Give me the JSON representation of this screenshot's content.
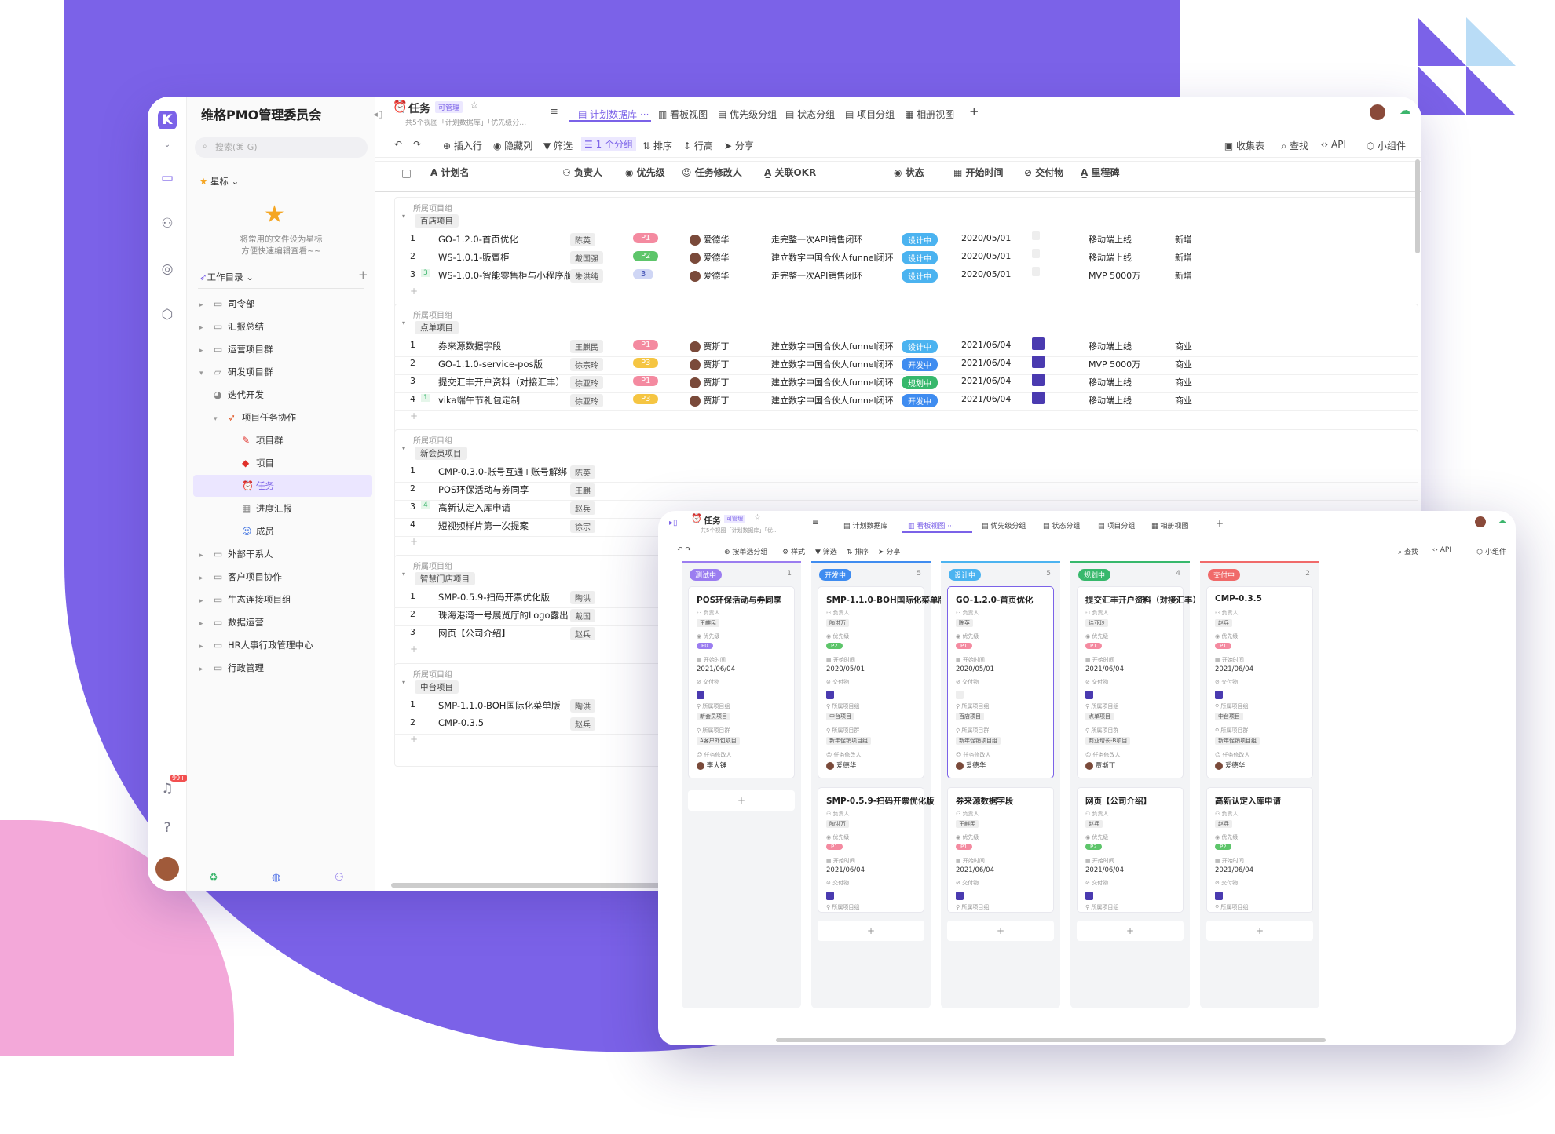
{
  "colors": {
    "brand": "#7b62e8",
    "pink": "#f3a8d9",
    "p0": "#9b7df0",
    "p1": "#f48aa0",
    "p2": "#5dc56a",
    "p3": "#f5c542",
    "status_design": "#4bb3f0",
    "status_dev": "#3f8cf0",
    "status_plan": "#37b86c",
    "status_test": "#9b7df0",
    "status_deliver": "#f06a6a"
  },
  "sidebar": {
    "workspace": "维格PMO管理委员会",
    "search_placeholder": "搜索(⌘ G)",
    "starred": "星标",
    "starred_hint": "将常用的文件设为星标\n方便快速编辑查看~~",
    "catalog": "工作目录",
    "items": [
      "司令部",
      "汇报总结",
      "运营项目群",
      "研发项目群",
      "迭代开发",
      "项目任务协作",
      "项目群",
      "项目",
      "任务",
      "进度汇报",
      "成员",
      "外部干系人",
      "客户项目协作",
      "生态连接项目组",
      "数据运营",
      "HR人事行政管理中心",
      "行政管理"
    ],
    "badge": "99+"
  },
  "header": {
    "title": "任务",
    "perm": "可管理",
    "desc": "共5个视图「计划数据库」「优先级分…",
    "tabs": [
      "计划数据库",
      "看板视图",
      "优先级分组",
      "状态分组",
      "项目分组",
      "相册视图"
    ]
  },
  "toolbar": {
    "undo": "↶",
    "redo": "↷",
    "insert": "插入行",
    "hide": "隐藏列",
    "filter": "筛选",
    "group": "1 个分组",
    "sort": "排序",
    "rowh": "行高",
    "share": "分享",
    "collect": "收集表",
    "find": "查找",
    "api": "API",
    "widget": "小组件"
  },
  "columns": [
    "计划名",
    "负责人",
    "优先级",
    "任务修改人",
    "关联OKR",
    "状态",
    "开始时间",
    "交付物",
    "里程碑"
  ],
  "group_label": "所属项目组",
  "groups": [
    {
      "name": "百店项目",
      "rows": [
        {
          "n": "1",
          "name": "GO-1.2.0-首页优化",
          "owner": "陈英",
          "pri": "P1",
          "editor": "爱德华",
          "okr": "走完整一次API销售闭环",
          "status": "设计中",
          "date": "2020/05/01",
          "mile": "移动端上线",
          "extra": "新增"
        },
        {
          "n": "2",
          "name": "WS-1.0.1-販賣柜",
          "owner": "戴国强",
          "pri": "P2",
          "editor": "爱德华",
          "okr": "建立数字中国合伙人funnel闭环",
          "status": "设计中",
          "date": "2020/05/01",
          "mile": "移动端上线",
          "extra": "新增"
        },
        {
          "n": "3",
          "sub": "3",
          "name": "WS-1.0.0-智能零售柜与小程序版",
          "owner": "朱洪纯",
          "pri": "3",
          "editor": "爱德华",
          "okr": "走完整一次API销售闭环",
          "status": "设计中",
          "date": "2020/05/01",
          "mile": "MVP 5000万",
          "extra": "新增"
        }
      ]
    },
    {
      "name": "点单项目",
      "rows": [
        {
          "n": "1",
          "name": "券来源数据字段",
          "owner": "王麒民",
          "pri": "P1",
          "editor": "贾斯丁",
          "okr": "建立数字中国合伙人funnel闭环",
          "status": "设计中",
          "date": "2021/06/04",
          "mile": "移动端上线",
          "extra": "商业"
        },
        {
          "n": "2",
          "name": "GO-1.1.0-service-pos版",
          "owner": "徐宗玲",
          "pri": "P3",
          "editor": "贾斯丁",
          "okr": "建立数字中国合伙人funnel闭环",
          "status": "开发中",
          "date": "2021/06/04",
          "mile": "MVP 5000万",
          "extra": "商业"
        },
        {
          "n": "3",
          "name": "提交汇丰开户资料（对接汇丰）",
          "owner": "徐亚玲",
          "pri": "P1",
          "editor": "贾斯丁",
          "okr": "建立数字中国合伙人funnel闭环",
          "status": "规划中",
          "date": "2021/06/04",
          "mile": "移动端上线",
          "extra": "商业"
        },
        {
          "n": "4",
          "sub": "1",
          "name": "vika端午节礼包定制",
          "owner": "徐亚玲",
          "pri": "P3",
          "editor": "贾斯丁",
          "okr": "建立数字中国合伙人funnel闭环",
          "status": "开发中",
          "date": "2021/06/04",
          "mile": "移动端上线",
          "extra": "商业"
        }
      ]
    },
    {
      "name": "新会员项目",
      "rows": [
        {
          "n": "1",
          "name": "CMP-0.3.0-账号互通+账号解绑",
          "owner": "陈英"
        },
        {
          "n": "2",
          "name": "POS环保活动与券同享",
          "owner": "王麒"
        },
        {
          "n": "3",
          "sub": "4",
          "name": "高新认定入库申请",
          "owner": "赵兵"
        },
        {
          "n": "4",
          "name": "短视频样片第一次提案",
          "owner": "徐宗"
        }
      ]
    },
    {
      "name": "智慧门店项目",
      "rows": [
        {
          "n": "1",
          "name": "SMP-0.5.9-扫码开票优化版",
          "owner": "陶洪"
        },
        {
          "n": "2",
          "name": "珠海港湾一号展览厅的Logo露出",
          "owner": "戴国"
        },
        {
          "n": "3",
          "name": "网页【公司介绍】",
          "owner": "赵兵"
        }
      ]
    },
    {
      "name": "中台项目",
      "rows": [
        {
          "n": "1",
          "name": "SMP-1.1.0-BOH国际化菜单版",
          "owner": "陶洪"
        },
        {
          "n": "2",
          "name": "CMP-0.3.5",
          "owner": "赵兵"
        }
      ]
    }
  ],
  "kanban": {
    "title": "任务",
    "perm": "可管理",
    "desc": "共5个视图「计划数据库」「优...",
    "tabs": [
      "计划数据库",
      "看板视图",
      "优先级分组",
      "状态分组",
      "项目分组",
      "相册视图"
    ],
    "tools": [
      "按单选分组",
      "样式",
      "筛选",
      "排序",
      "分享",
      "查找",
      "API",
      "小组件"
    ],
    "labels": {
      "owner": "负责人",
      "pri": "优先级",
      "start": "开始时间",
      "deliv": "交付物",
      "proj": "所属项目组",
      "projgroup": "所属项目群",
      "editor": "任务修改人"
    },
    "columns": [
      {
        "status": "测试中",
        "count": "1",
        "cards": [
          {
            "title": "POS环保活动与券同享",
            "owner": "王麒民",
            "pri": "P0",
            "date": "2021/06/04",
            "proj": "新会员项目",
            "pg": "A客户外包项目",
            "editor": "李大锤"
          }
        ]
      },
      {
        "status": "开发中",
        "count": "5",
        "cards": [
          {
            "title": "SMP-1.1.0-BOH国际化菜单版",
            "owner": "陶洪万",
            "pri": "P2",
            "date": "2020/05/01",
            "proj": "中台项目",
            "pg": "新年促销项目组",
            "editor": "爱德华"
          },
          {
            "title": "SMP-0.5.9-扫码开票优化版",
            "owner": "陶洪万",
            "pri": "P1",
            "date": "2021/06/04"
          }
        ]
      },
      {
        "status": "设计中",
        "count": "5",
        "cards": [
          {
            "title": "GO-1.2.0-首页优化",
            "owner": "陈英",
            "pri": "P1",
            "date": "2020/05/01",
            "proj": "百店项目",
            "pg": "新年促销项目组",
            "editor": "爱德华"
          },
          {
            "title": "券来源数据字段",
            "owner": "王麒民",
            "pri": "P1",
            "date": "2021/06/04"
          }
        ]
      },
      {
        "status": "规划中",
        "count": "4",
        "cards": [
          {
            "title": "提交汇丰开户资料（对接汇丰）",
            "owner": "徐亚玲",
            "pri": "P1",
            "date": "2021/06/04",
            "proj": "点单项目",
            "pg": "商业增长-B项目",
            "editor": "贾斯丁"
          },
          {
            "title": "网页【公司介绍】",
            "owner": "赵兵",
            "pri": "P2",
            "date": "2021/06/04"
          }
        ]
      },
      {
        "status": "交付中",
        "count": "2",
        "cards": [
          {
            "title": "CMP-0.3.5",
            "owner": "赵兵",
            "pri": "P1",
            "date": "2021/06/04",
            "proj": "中台项目",
            "pg": "新年促销项目组",
            "editor": "爱德华"
          },
          {
            "title": "高新认定入库申请",
            "owner": "赵兵",
            "pri": "P2",
            "date": "2021/06/04"
          }
        ]
      }
    ]
  }
}
